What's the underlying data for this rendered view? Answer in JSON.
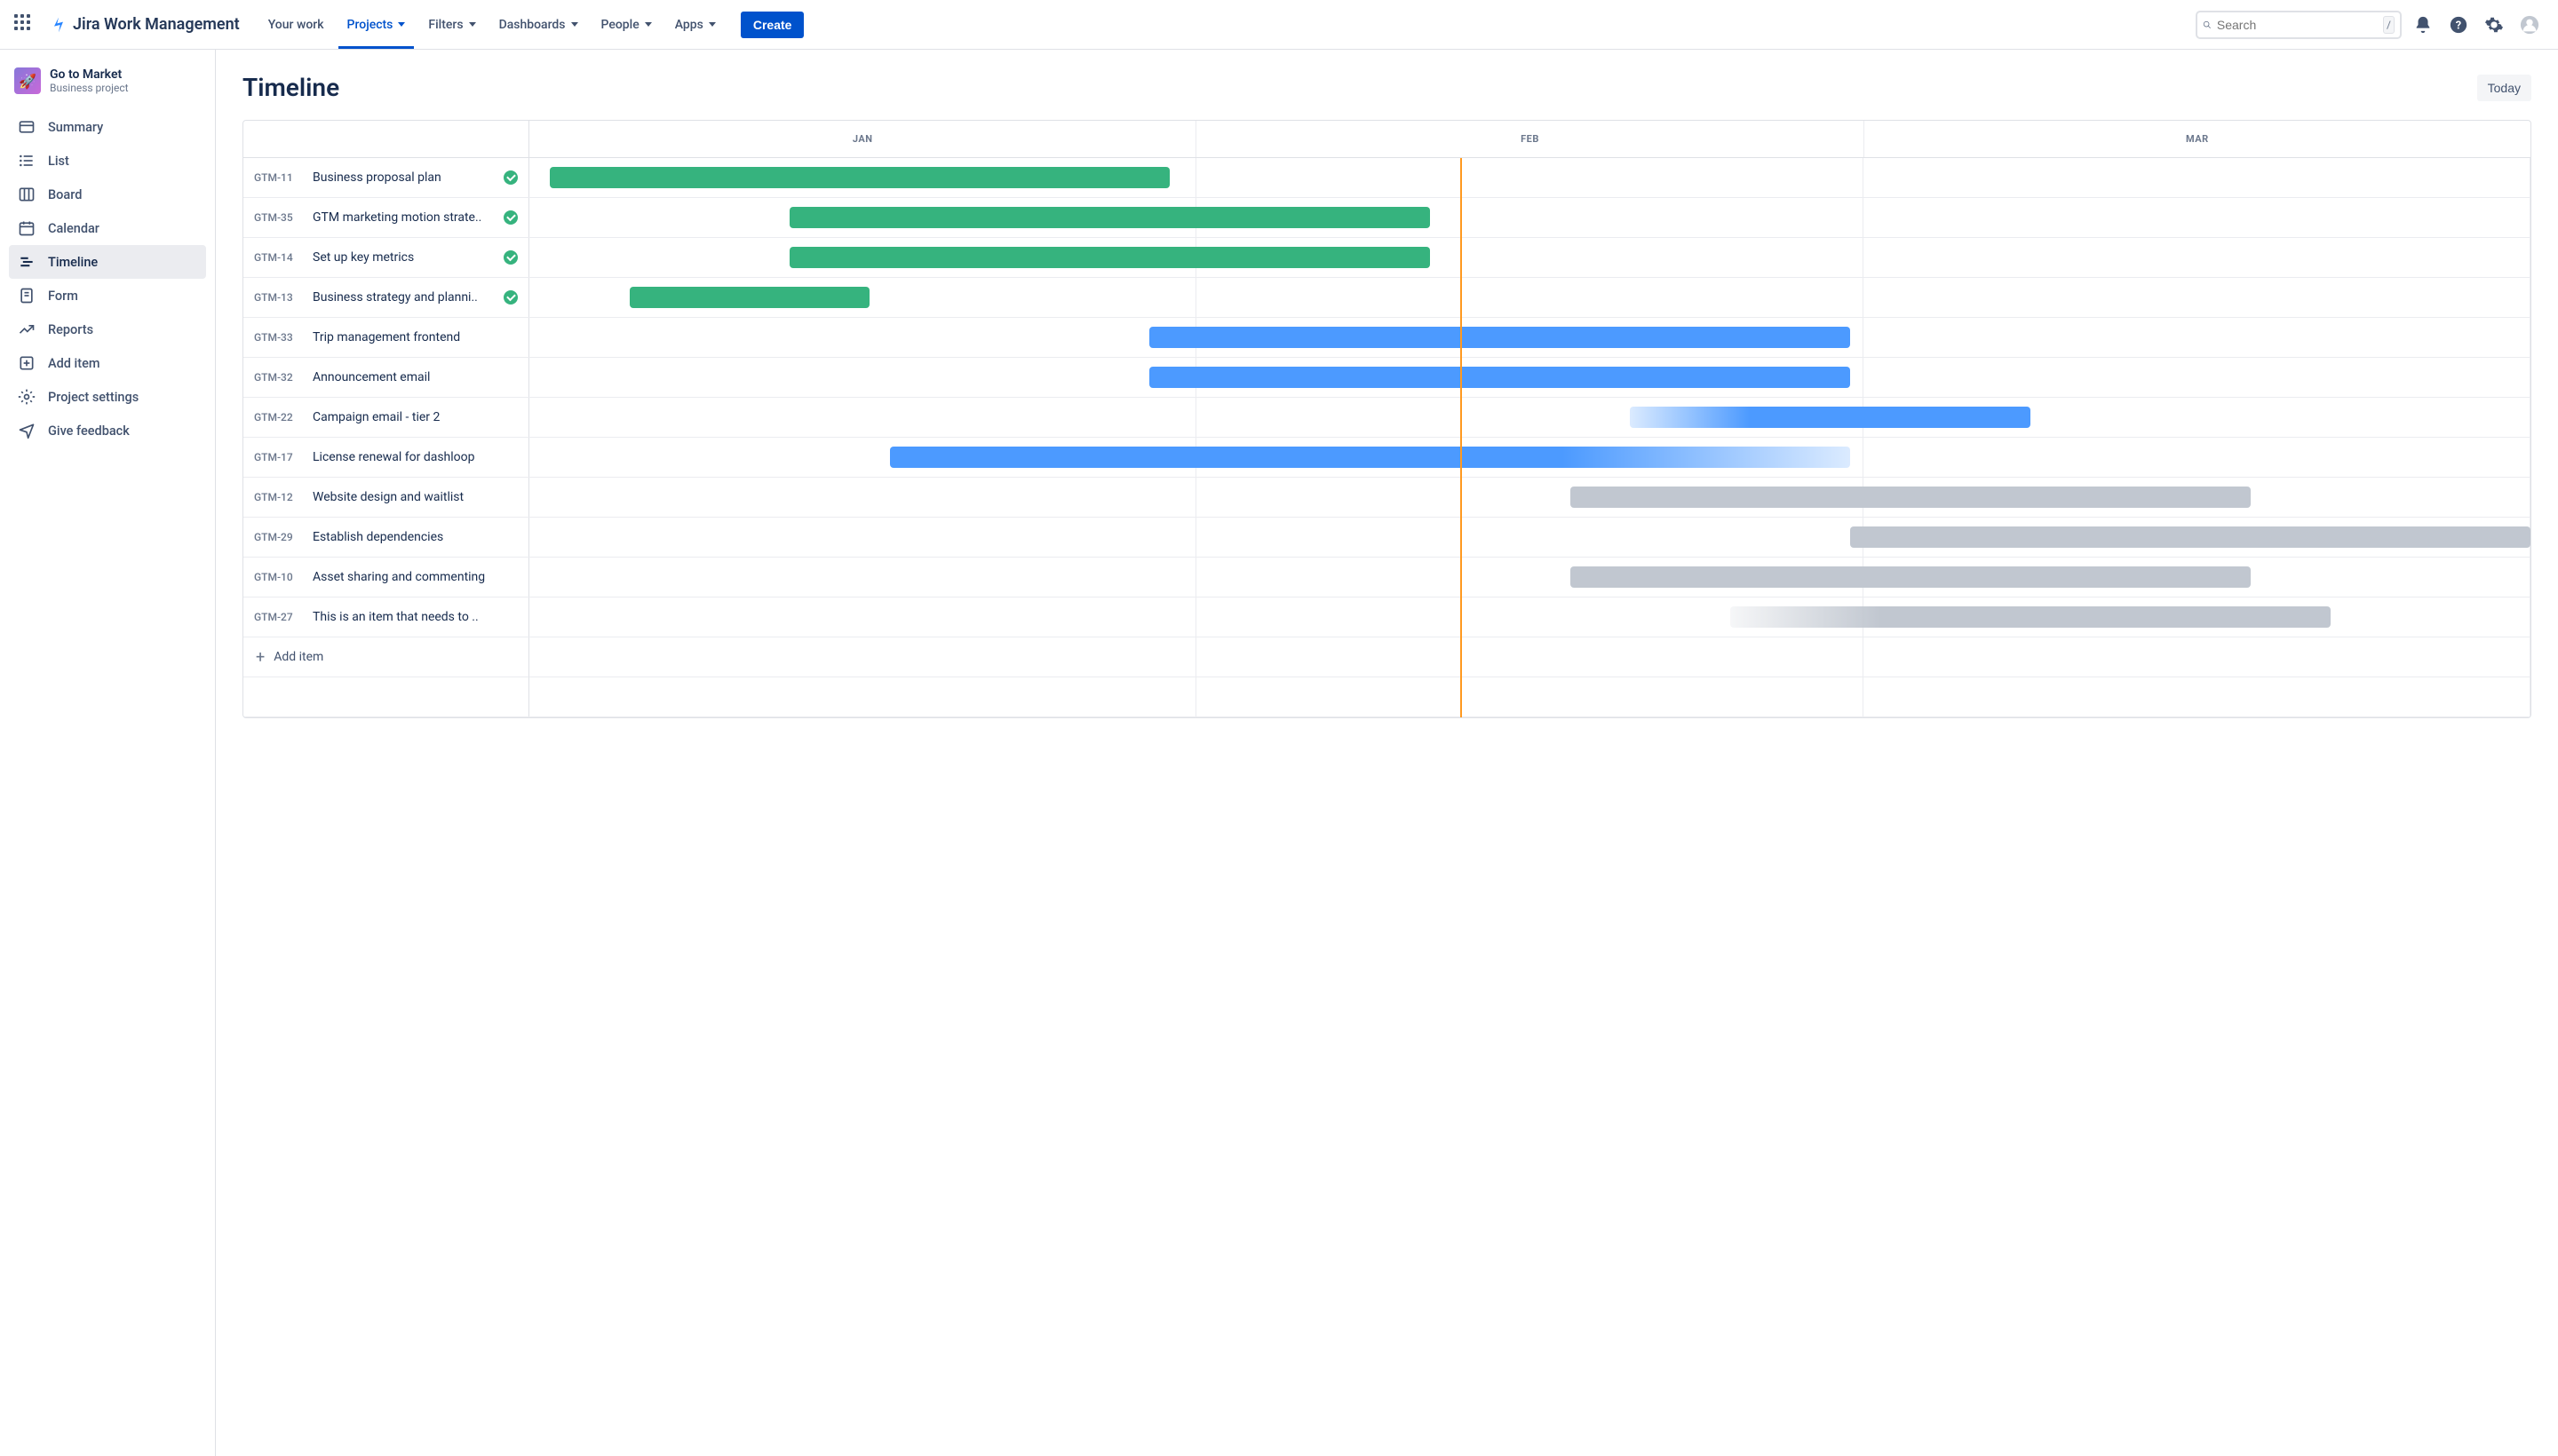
{
  "header": {
    "product": "Jira Work Management",
    "nav": [
      "Your work",
      "Projects",
      "Filters",
      "Dashboards",
      "People",
      "Apps"
    ],
    "nav_dropdown": [
      false,
      true,
      true,
      true,
      true,
      true
    ],
    "nav_active": 1,
    "create": "Create",
    "search_placeholder": "Search",
    "search_kbd": "/"
  },
  "project": {
    "name": "Go to Market",
    "subtitle": "Business project"
  },
  "sidebar": {
    "items": [
      "Summary",
      "List",
      "Board",
      "Calendar",
      "Timeline",
      "Form",
      "Reports",
      "Add item",
      "Project settings",
      "Give feedback"
    ],
    "active": 4
  },
  "page": {
    "title": "Timeline",
    "today_btn": "Today",
    "add_item": "Add item"
  },
  "timeline": {
    "months": [
      "JAN",
      "FEB",
      "MAR"
    ],
    "today_position_pct": 46.5,
    "tasks": [
      {
        "key": "GTM-11",
        "title": "Business proposal plan",
        "done": true,
        "bar": {
          "start": 1,
          "end": 32,
          "color": "green"
        }
      },
      {
        "key": "GTM-35",
        "title": "GTM marketing motion strate..",
        "done": true,
        "bar": {
          "start": 13,
          "end": 45,
          "color": "green"
        }
      },
      {
        "key": "GTM-14",
        "title": "Set up key metrics",
        "done": true,
        "bar": {
          "start": 13,
          "end": 45,
          "color": "green"
        }
      },
      {
        "key": "GTM-13",
        "title": "Business strategy and planni..",
        "done": true,
        "bar": {
          "start": 5,
          "end": 17,
          "color": "green"
        }
      },
      {
        "key": "GTM-33",
        "title": "Trip management frontend",
        "done": false,
        "bar": {
          "start": 31,
          "end": 66,
          "color": "blue"
        }
      },
      {
        "key": "GTM-32",
        "title": "Announcement email",
        "done": false,
        "bar": {
          "start": 31,
          "end": 66,
          "color": "blue"
        }
      },
      {
        "key": "GTM-22",
        "title": "Campaign email - tier 2",
        "done": false,
        "bar": {
          "start": 55,
          "end": 75,
          "color": "blue",
          "fade": "left"
        }
      },
      {
        "key": "GTM-17",
        "title": "License renewal for dashloop",
        "done": false,
        "bar": {
          "start": 18,
          "end": 66,
          "color": "blue",
          "fade": "right"
        }
      },
      {
        "key": "GTM-12",
        "title": "Website design and waitlist",
        "done": false,
        "bar": {
          "start": 52,
          "end": 86,
          "color": "grey"
        }
      },
      {
        "key": "GTM-29",
        "title": "Establish dependencies",
        "done": false,
        "bar": {
          "start": 66,
          "end": 100,
          "color": "grey"
        }
      },
      {
        "key": "GTM-10",
        "title": "Asset sharing and commenting",
        "done": false,
        "bar": {
          "start": 52,
          "end": 86,
          "color": "grey"
        }
      },
      {
        "key": "GTM-27",
        "title": "This is an item that needs to ..",
        "done": false,
        "bar": {
          "start": 60,
          "end": 90,
          "color": "grey",
          "fade": "left"
        }
      }
    ]
  }
}
